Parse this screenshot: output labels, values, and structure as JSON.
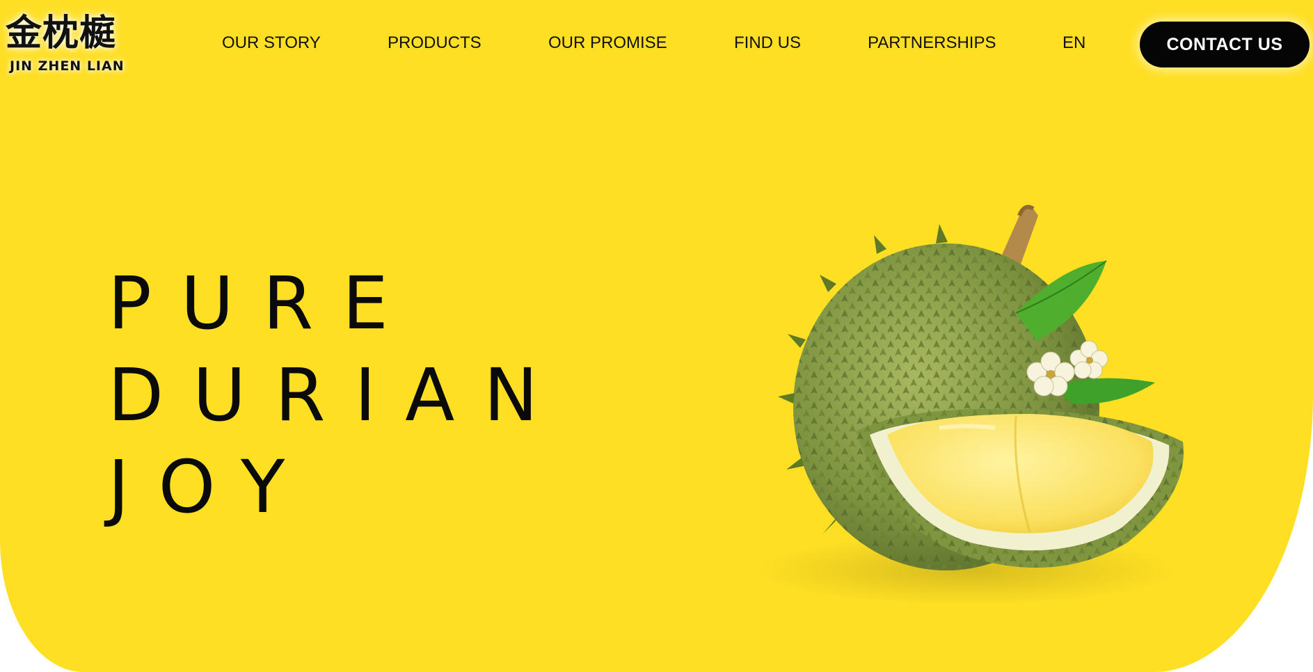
{
  "brand": {
    "logo_chinese": "金枕榳",
    "logo_english": "JIN ZHEN LIAN"
  },
  "nav": {
    "items": [
      "OUR STORY",
      "PRODUCTS",
      "OUR PROMISE",
      "FIND US",
      "PARTNERSHIPS"
    ],
    "language": "EN",
    "contact_label": "CONTACT US"
  },
  "hero": {
    "line1": "PURE",
    "line2": "DURIAN",
    "line3": "JOY",
    "image": "durian-fruit-with-flowers"
  },
  "colors": {
    "background": "#fedf24",
    "text": "#0a0a0a",
    "button": "#050505",
    "button_text": "#ffffff"
  }
}
